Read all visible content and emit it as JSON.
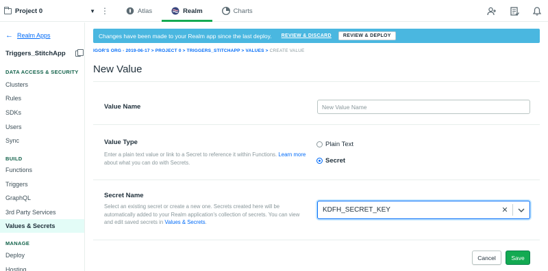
{
  "topbar": {
    "project_name": "Project 0",
    "tabs": [
      {
        "label": "Atlas",
        "icon": "atlas-leaf-icon"
      },
      {
        "label": "Realm",
        "icon": "realm-icon",
        "active": true
      },
      {
        "label": "Charts",
        "icon": "charts-icon"
      }
    ],
    "icons": [
      "invite-user-icon",
      "activity-feed-icon",
      "bell-icon"
    ]
  },
  "sidebar": {
    "back_label": "Realm Apps",
    "app_name": "Triggers_StitchApp",
    "sections": {
      "data_access": "DATA ACCESS & SECURITY",
      "build": "BUILD",
      "manage": "MANAGE"
    },
    "data_access_items": [
      "Clusters",
      "Rules",
      "SDKs",
      "Users",
      "Sync"
    ],
    "build_items": [
      "Functions",
      "Triggers",
      "GraphQL",
      "3rd Party Services",
      "Values & Secrets"
    ],
    "manage_items": [
      "Deploy",
      "Hosting"
    ],
    "active_item": "Values & Secrets"
  },
  "banner": {
    "message": "Changes have been made to your Realm app since the last deploy.",
    "review_discard": "REVIEW & DISCARD",
    "review_deploy": "REVIEW & DEPLOY",
    "color": "#4ab7e0"
  },
  "breadcrumb": {
    "links": "IGOR'S ORG - 2019-06-17 > PROJECT 0 > TRIGGERS_STITCHAPP > VALUES >",
    "current": " CREATE VALUE"
  },
  "page_title": "New Value",
  "form": {
    "value_name": {
      "label": "Value Name",
      "value": "",
      "placeholder": "New Value Name"
    },
    "value_type": {
      "label": "Value Type",
      "desc_before": "Enter a plain text value or link to a Secret to reference it within Functions. ",
      "desc_link": "Learn more",
      "desc_after": " about what you can do with Secrets.",
      "options": [
        "Plain Text",
        "Secret"
      ],
      "selected": "Secret"
    },
    "secret_name": {
      "label": "Secret Name",
      "desc_before": "Select an existing secret or create a new one. Secrets created here will be automatically added to your Realm application's collection of secrets. You can view and edit saved secrets in ",
      "desc_link": "Values & Secrets",
      "desc_after": ".",
      "selected_value": "KDFH_SECRET_KEY"
    }
  },
  "actions": {
    "cancel": "Cancel",
    "save": "Save"
  },
  "colors": {
    "accent_green": "#13aa52",
    "link_blue": "#016bf8"
  }
}
